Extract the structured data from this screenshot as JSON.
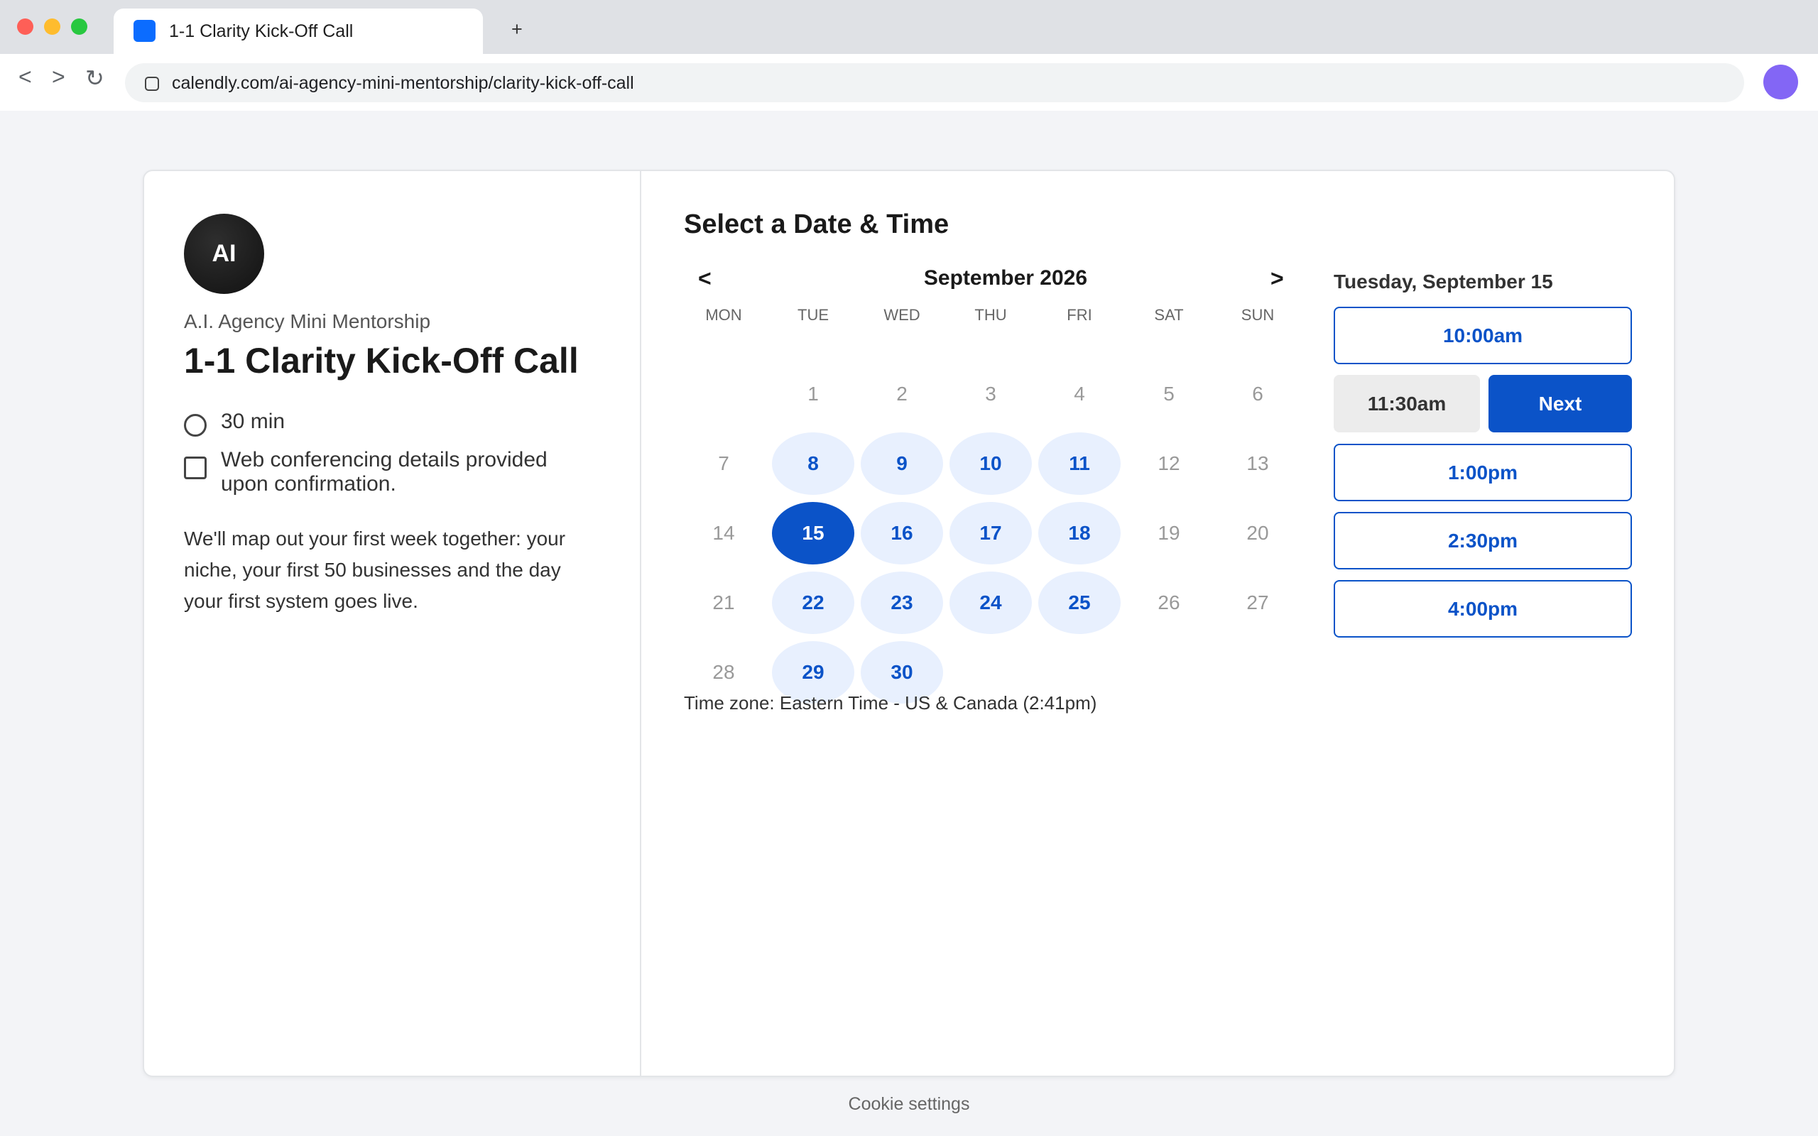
{
  "browser": {
    "tab_title": "1-1 Clarity Kick-Off Call",
    "new_tab_symbol": "+",
    "nav": {
      "back": "<",
      "forward": ">",
      "reload": "↻"
    },
    "url": "calendly.com/ai-agency-mini-mentorship/clarity-kick-off-call",
    "colors": {
      "favicon": "#0b6cff",
      "profile": "#8366f5"
    }
  },
  "event": {
    "avatar_initials": "AI",
    "organization": "A.I. Agency Mini Mentorship",
    "title": "1-1 Clarity Kick-Off Call",
    "duration": "30 min",
    "conferencing": "Web conferencing details provided upon confirmation.",
    "description": "We'll map out your first week together: your niche, your first 50 businesses and the day your first system goes live."
  },
  "scheduler": {
    "heading": "Select a Date & Time",
    "month": "September 2026",
    "prev_symbol": "<",
    "next_symbol": ">",
    "weekdays": [
      "MON",
      "TUE",
      "WED",
      "THU",
      "FRI",
      "SAT",
      "SUN"
    ],
    "days": [
      {
        "d": "1",
        "s": "disabled"
      },
      {
        "d": "2",
        "s": "disabled"
      },
      {
        "d": "3",
        "s": "disabled"
      },
      {
        "d": "4",
        "s": "disabled"
      },
      {
        "d": "5",
        "s": "disabled"
      },
      {
        "d": "6",
        "s": "disabled"
      },
      {
        "d": "7",
        "s": "disabled"
      },
      {
        "d": "8",
        "s": "avail"
      },
      {
        "d": "9",
        "s": "avail"
      },
      {
        "d": "10",
        "s": "avail"
      },
      {
        "d": "11",
        "s": "avail"
      },
      {
        "d": "12",
        "s": "disabled"
      },
      {
        "d": "13",
        "s": "disabled"
      },
      {
        "d": "14",
        "s": "disabled"
      },
      {
        "d": "15",
        "s": "selected"
      },
      {
        "d": "16",
        "s": "avail"
      },
      {
        "d": "17",
        "s": "avail"
      },
      {
        "d": "18",
        "s": "avail"
      },
      {
        "d": "19",
        "s": "disabled"
      },
      {
        "d": "20",
        "s": "disabled"
      },
      {
        "d": "21",
        "s": "disabled"
      },
      {
        "d": "22",
        "s": "avail"
      },
      {
        "d": "23",
        "s": "avail"
      },
      {
        "d": "24",
        "s": "avail"
      },
      {
        "d": "25",
        "s": "avail"
      },
      {
        "d": "26",
        "s": "disabled"
      },
      {
        "d": "27",
        "s": "disabled"
      },
      {
        "d": "28",
        "s": "disabled"
      },
      {
        "d": "29",
        "s": "avail"
      },
      {
        "d": "30",
        "s": "avail"
      }
    ],
    "timezone": "Time zone: Eastern Time - US & Canada (2:41pm)",
    "selected_date_heading": "Tuesday, September 15",
    "slots": {
      "first": "10:00am",
      "selected": "11:30am",
      "next_label": "Next",
      "rest": [
        "1:00pm",
        "2:30pm",
        "4:00pm"
      ]
    },
    "colors": {
      "primary": "#0b53c8",
      "available_bg": "#e8f0fe"
    }
  },
  "footer": {
    "cookie_settings": "Cookie settings"
  }
}
